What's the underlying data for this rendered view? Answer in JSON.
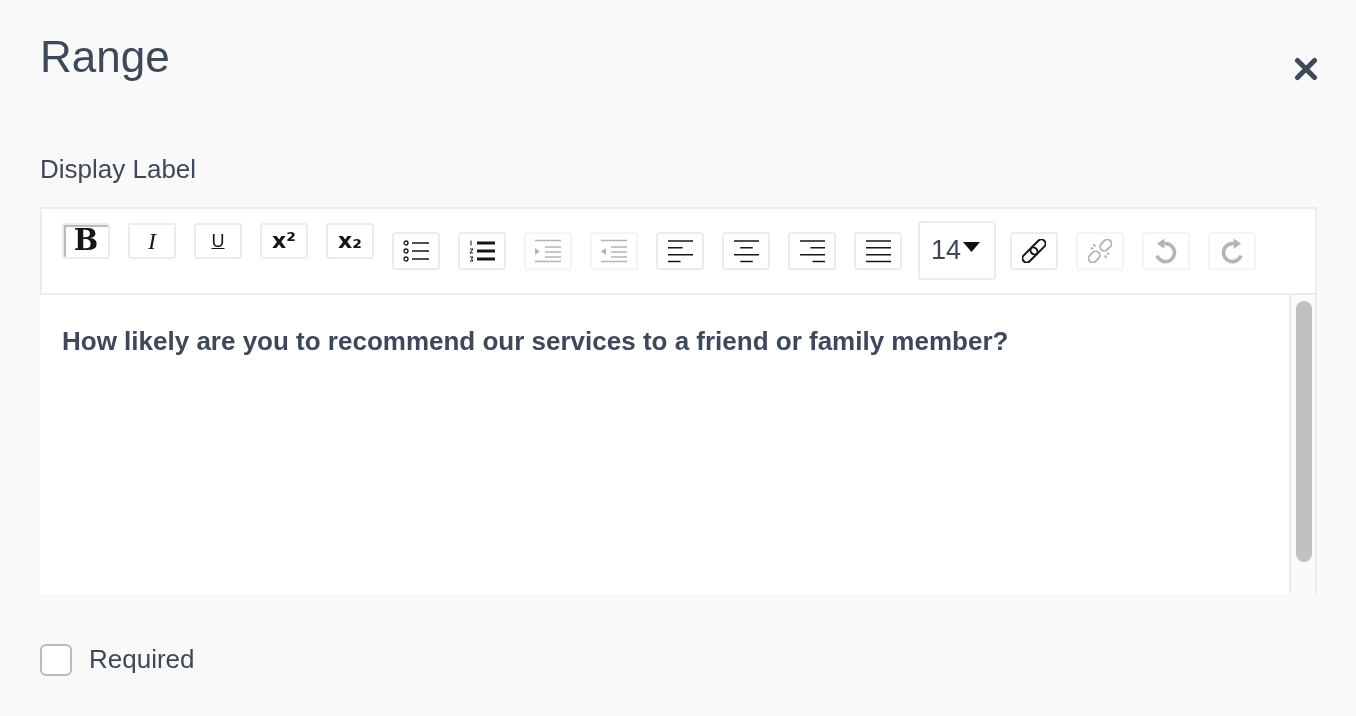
{
  "dialog": {
    "title": "Range"
  },
  "display_label": {
    "label": "Display Label",
    "toolbar": [
      {
        "kind": "bold",
        "label": "B",
        "active": true,
        "disabled": false
      },
      {
        "kind": "italic",
        "label": "I",
        "active": false,
        "disabled": false
      },
      {
        "kind": "underline",
        "label": "U",
        "active": false,
        "disabled": false
      },
      {
        "kind": "superscript",
        "label": "x²",
        "active": false,
        "disabled": false
      },
      {
        "kind": "subscript",
        "label": "x₂",
        "active": false,
        "disabled": false
      },
      {
        "kind": "bullets",
        "active": false,
        "disabled": false
      },
      {
        "kind": "numbering",
        "active": false,
        "disabled": false
      },
      {
        "kind": "indent",
        "active": false,
        "disabled": true
      },
      {
        "kind": "outdent",
        "active": false,
        "disabled": true
      },
      {
        "kind": "alignleft",
        "active": false,
        "disabled": false
      },
      {
        "kind": "aligncenter",
        "active": false,
        "disabled": false
      },
      {
        "kind": "alignright",
        "active": false,
        "disabled": false
      },
      {
        "kind": "justify",
        "active": false,
        "disabled": false
      },
      {
        "kind": "fontsize",
        "value": "14"
      },
      {
        "kind": "link",
        "active": false,
        "disabled": false
      },
      {
        "kind": "unlink",
        "active": false,
        "disabled": true
      },
      {
        "kind": "undo",
        "active": false,
        "disabled": true
      },
      {
        "kind": "redo",
        "active": false,
        "disabled": true
      }
    ],
    "value": "How likely are you to recommend our services to a friend or family member?"
  },
  "required": {
    "label": "Required",
    "checked": false
  }
}
